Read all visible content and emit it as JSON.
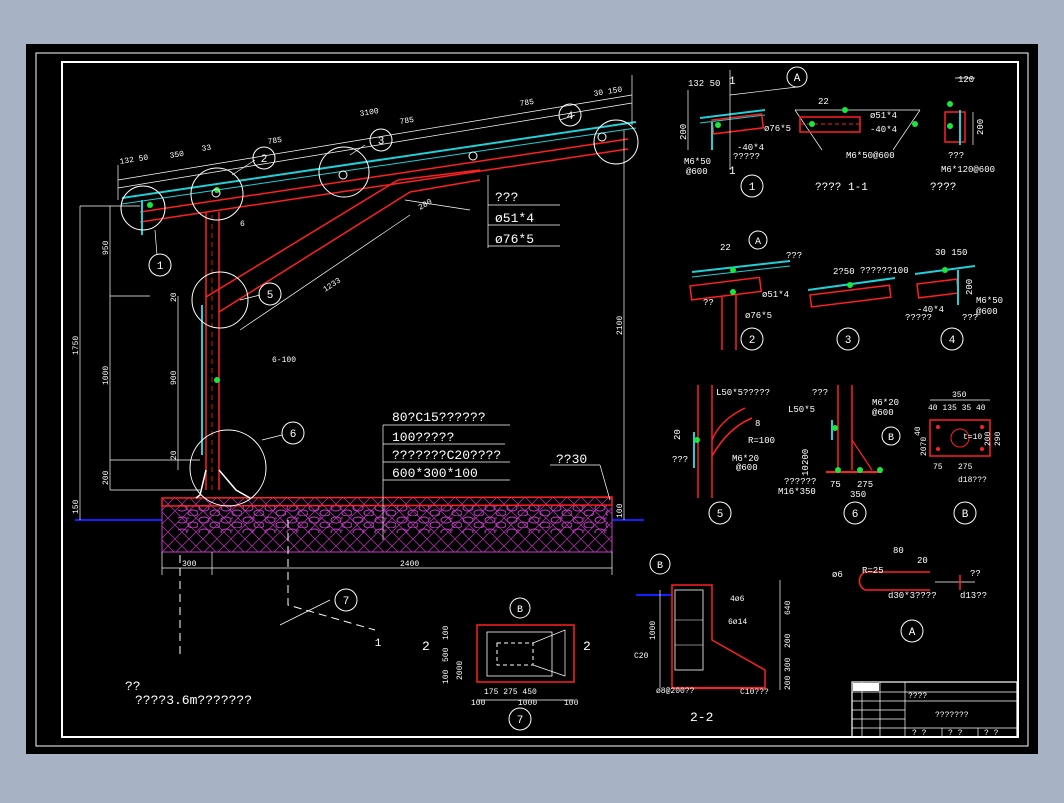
{
  "colors": {
    "background": "#a7b3c5",
    "canvas": "#000000",
    "frame": "#ffffff",
    "structure": "#ff2020",
    "roof": "#22cfd6",
    "anchor": "#17e83a",
    "ground_line": "#1020ff",
    "gravel": "#c83ccc",
    "dims": "#ffffff"
  },
  "main": {
    "dims": {
      "total_span": "3100",
      "top_785": "785",
      "mid_785": "785",
      "span_785": "785",
      "end_30_150": "30 150",
      "left_132_50": "132 50",
      "seg_350": "350",
      "seg_33": "33",
      "brace_280": "280",
      "brace_1233": "1233",
      "h_950": "950",
      "h_1750": "1750",
      "h_1000": "1000",
      "h_200": "200",
      "h_150": "150",
      "h_900": "900",
      "h_20a": "20",
      "h_20b": "20",
      "h_2100": "2100",
      "h_100": "100",
      "base_300": "300",
      "base_2400": "2400",
      "plate_6": "6",
      "plate_6_100": "6-100"
    },
    "pipe_table": {
      "header": "???",
      "row1": "ø51*4",
      "row2": "ø76*5"
    },
    "foundation_notes": {
      "l1": "80?C15??????",
      "l2": "100?????",
      "l3": "???????C20????",
      "l4": "600*300*100"
    },
    "slope_label": "??30",
    "callouts": {
      "c1": "1",
      "c2": "2",
      "c3": "3",
      "c4": "4",
      "c5": "5",
      "c6": "6",
      "c7": "7"
    },
    "section_mark": "1"
  },
  "note": {
    "title": "??",
    "body": "????3.6m???????"
  },
  "detail1": {
    "bubble": "1",
    "a": "A",
    "mark1": "1",
    "mark2": "1",
    "dim_132_50": "132 50",
    "dim_200": "200",
    "pipe76": "ø76*5",
    "plate": "-40*4",
    "q": "?????",
    "bolt": "M6*50",
    "spacing": "@600"
  },
  "sec11": {
    "title": "????  1-1",
    "a": "A",
    "dim_22": "22",
    "pipe51": "ø51*4",
    "plate": "-40*4",
    "bolt": "M6*50@600"
  },
  "detail_r": {
    "title": "????",
    "dim_120": "120",
    "dim_200": "200",
    "q": "???",
    "bolt": "M6*120@600"
  },
  "detail2": {
    "bubble": "2",
    "a": "A",
    "dim_22": "22",
    "q1": "???",
    "q2": "??",
    "pipe51": "ø51*4",
    "pipe76": "ø76*5"
  },
  "detail3": {
    "bubble": "3",
    "label": "??????100",
    "dim": "2?50"
  },
  "detail4": {
    "bubble": "4",
    "dim_30_150": "30 150",
    "dim_200": "200",
    "plate": "-40*4",
    "q1": "?????",
    "q2": "???",
    "bolt": "M6*50",
    "spacing": "@600"
  },
  "detail5": {
    "bubble": "5",
    "angle": "L50*5?????",
    "dim_20": "20",
    "dim_8": "8",
    "radius": "R=100",
    "q": "???",
    "bolt": "M6*20",
    "spacing": "@600"
  },
  "detail6": {
    "bubble": "6",
    "b": "B",
    "q1": "???",
    "angle": "L50*5",
    "bolt": "M6*20",
    "spacing": "@600",
    "dim_200": "200",
    "dim_10": "10",
    "dim_75": "75",
    "dim_275": "275",
    "dim_350": "350",
    "q2": "??????",
    "anchor": "M16*350"
  },
  "detailB": {
    "bubble": "B",
    "dim_350": "350",
    "dim_row": "40 135  35 40",
    "dim_290": "290",
    "dim_200": "200",
    "dim_40": "40",
    "dim_2070": "2070",
    "plate_t": "t=10",
    "dim_75": "75",
    "dim_275": "275",
    "hole": "d18???"
  },
  "detailA": {
    "bubble": "A",
    "dim_80": "80",
    "dim_20": "20",
    "radius": "R=25",
    "d6": "ø6",
    "bolt": "d30*3????",
    "q": "??",
    "washer": "d13??"
  },
  "detail7": {
    "bubble": "7",
    "b": "B",
    "cut_l": "2",
    "cut_r": "2",
    "v_dims": [
      "100",
      "500",
      "2000",
      "100"
    ],
    "h_row": "175  275   450",
    "total": "1000",
    "h_100a": "100",
    "h_100b": "100"
  },
  "sec22": {
    "title": "2-2",
    "b": "B",
    "r1": "4ø6",
    "r2": "6ø14",
    "c20": "C20",
    "bottom_l": "ø8@200??",
    "bottom_r": "C10???",
    "h_1000": "1000",
    "r_640": "640",
    "r_200": "200",
    "r_300": "300",
    "r_200b": "200"
  },
  "titleblock": {
    "title": "???????",
    "r1": "????",
    "b1": "? ?",
    "b2": "? ?",
    "b3": "? ?"
  }
}
